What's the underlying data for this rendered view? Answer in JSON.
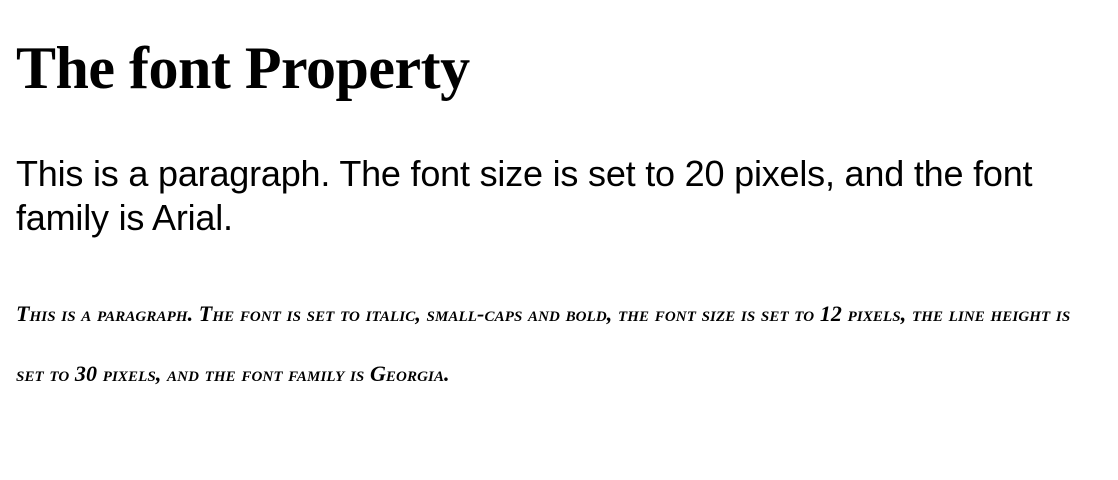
{
  "document": {
    "heading": "The font Property",
    "paragraph_arial": "This is a paragraph. The font size is set to 20 pixels, and the font family is Arial.",
    "paragraph_georgia": "This is a paragraph. The font is set to italic, small-caps and bold, the font size is set to 12 pixels, the line height is set to 30 pixels, and the font family is Georgia."
  }
}
